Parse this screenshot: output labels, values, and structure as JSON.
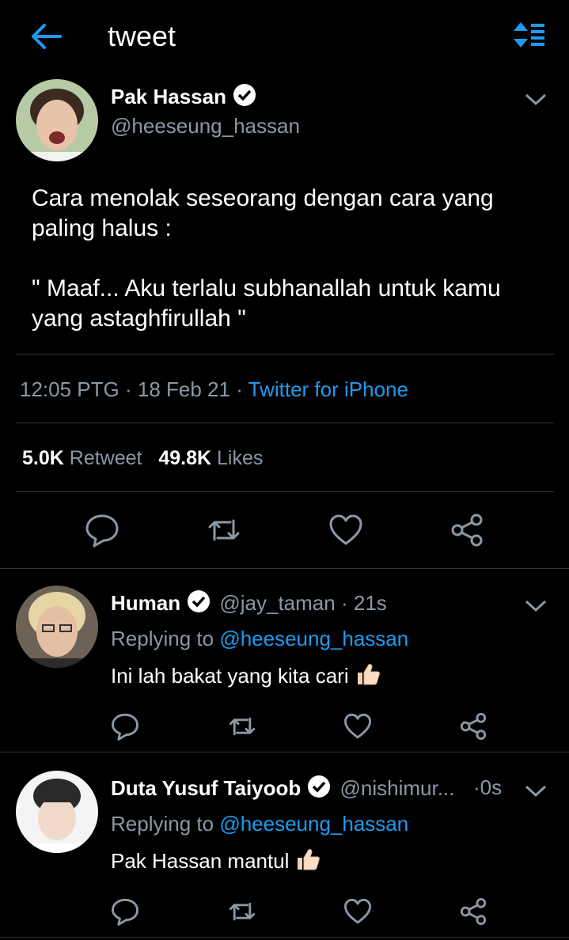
{
  "header": {
    "title": "tweet",
    "back_icon": "back-arrow-icon",
    "sort_icon": "sort-icon",
    "accent": "#1d9bf0"
  },
  "tweet": {
    "name": "Pak Hassan",
    "handle": "@heeseung_hassan",
    "body_line1": "Cara menolak seseorang dengan cara yang",
    "body_line2": "paling halus :",
    "body_line3": "\" Maaf... Aku terlalu subhanallah untuk kamu",
    "body_line4": "yang astaghfirullah \"",
    "time": "12:05 PTG",
    "date": "18 Feb 21",
    "source": "Twitter for iPhone",
    "retweet_count": "5.0K",
    "retweet_label": "Retweet",
    "likes_count": "49.8K",
    "likes_label": "Likes"
  },
  "replies": [
    {
      "name": "Human",
      "handle": "@jay_taman",
      "time": "21s",
      "replying_label": "Replying to",
      "replying_handle": "@heeseung_hassan",
      "text": "Ini lah bakat yang kita cari"
    },
    {
      "name": "Duta Yusuf Taiyoob",
      "handle": "@nishimur...",
      "time": "0s",
      "replying_label": "Replying to",
      "replying_handle": "@heeseung_hassan",
      "text": "Pak Hassan mantul"
    }
  ],
  "separator": "·"
}
